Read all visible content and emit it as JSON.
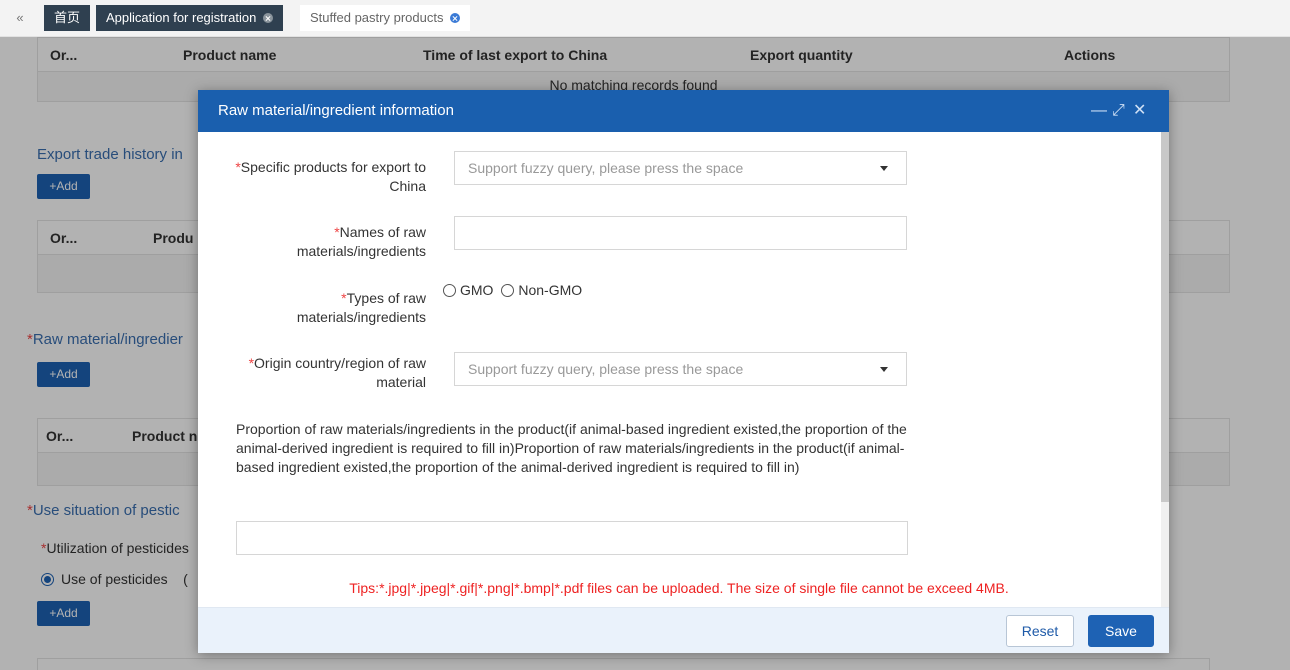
{
  "tabs": {
    "nav_icon": "«",
    "items": [
      {
        "label": "首页",
        "closable": false
      },
      {
        "label": "Application for registration",
        "closable": true
      },
      {
        "label": "Stuffed pastry products",
        "closable": true
      }
    ]
  },
  "background": {
    "table1": {
      "headers": [
        "Or...",
        "Product name",
        "Time of last export to China",
        "Export quantity",
        "Actions"
      ],
      "empty_text": "No matching records found"
    },
    "export_trade_title": "Export trade history in",
    "add_label": "+Add",
    "table2": {
      "headers": [
        "Or...",
        "Produ"
      ]
    },
    "raw_material_title": "Raw material/ingredier",
    "table3": {
      "headers": [
        "Or...",
        "Product n"
      ]
    },
    "pesticide_title": "Use situation of pestic",
    "pesticide_sub": "Utilization of pesticides",
    "pesticide_radio": "Use of pesticides",
    "pesticide_radio_tail": "("
  },
  "modal": {
    "title": "Raw material/ingredient information",
    "header_icons": {
      "minimize": "—",
      "maximize": "⤢",
      "close": "✕"
    },
    "fields": {
      "specific_products": {
        "label_line1": "Specific products for export to",
        "label_line2": "China",
        "placeholder": "Support fuzzy query, please press the space"
      },
      "names": {
        "label_line1": "Names of raw",
        "label_line2": "materials/ingredients",
        "value": ""
      },
      "types": {
        "label_line1": "Types of raw",
        "label_line2": "materials/ingredients",
        "options": [
          "GMO",
          "Non-GMO"
        ]
      },
      "origin": {
        "label_line1": "Origin country/region of raw",
        "label_line2": "material",
        "placeholder": "Support fuzzy query, please press the space"
      },
      "proportion": {
        "label": "Proportion of raw materials/ingredients in the product(if animal-based ingredient existed,the proportion of the animal-derived ingredient is required to fill in)Proportion of raw materials/ingredients in the product(if animal-based ingredient existed,the proportion of the animal-derived ingredient is required to fill in)",
        "value": ""
      }
    },
    "required_mark": "*",
    "tips": "Tips:*.jpg|*.jpeg|*.gif|*.png|*.bmp|*.pdf files can be uploaded. The size of single file cannot be exceed 4MB.",
    "buttons": {
      "reset": "Reset",
      "save": "Save"
    }
  },
  "colors": {
    "header_blue": "#1a5fae",
    "button_blue": "#1e62b4",
    "required_red": "#e44",
    "tips_red": "#e22",
    "tab_dark": "#2f4050"
  }
}
